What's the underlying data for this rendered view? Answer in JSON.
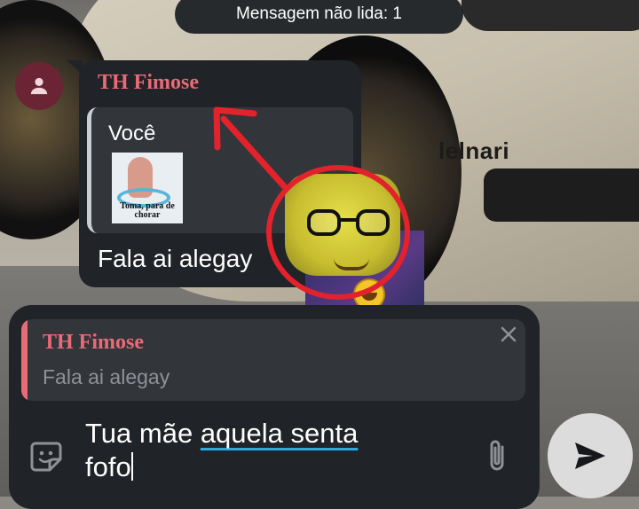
{
  "banner": {
    "unread": "Mensagem não lida: 1"
  },
  "wallpaper": {
    "brand": "lelnari"
  },
  "message": {
    "sender": "TH Fimose",
    "quote_author": "Você",
    "quote_image_caption": "Toma, para de chorar",
    "text": "Fala ai alegay"
  },
  "composer": {
    "reply_name": "TH Fimose",
    "reply_text": "Fala ai alegay",
    "input_plain": "Tua mãe ",
    "input_underlined": "aquela senta",
    "input_line2": "fofo"
  },
  "icons": {
    "avatar": "person-icon",
    "close": "close-icon",
    "emoji": "sticker-icon",
    "attach": "paperclip-icon",
    "send": "send-icon"
  },
  "colors": {
    "bubble": "#202327",
    "sender": "#e96b75",
    "accent_underline": "#2fa8df",
    "annotation_red": "#e3222b"
  }
}
